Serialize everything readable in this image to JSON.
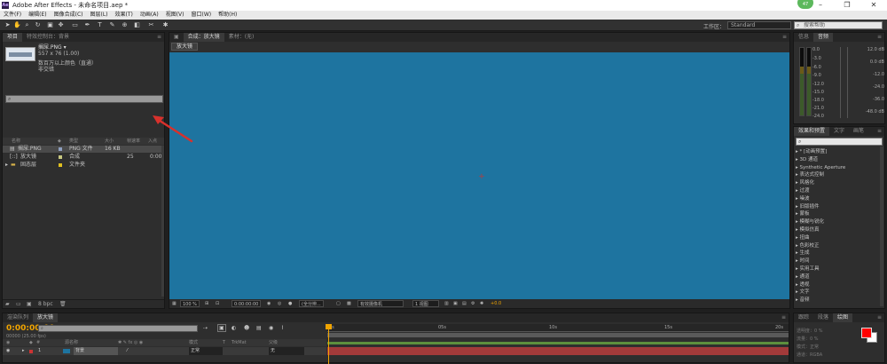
{
  "window": {
    "title": "Adobe After Effects - 未命名项目.aep *",
    "app_icon": "Ae",
    "badge": "47"
  },
  "menu": [
    "文件(F)",
    "编辑(E)",
    "图像合成(C)",
    "图层(L)",
    "效果(T)",
    "动画(A)",
    "视图(V)",
    "窗口(W)",
    "帮助(H)"
  ],
  "toolbar": {
    "workspace_label": "工作区：",
    "workspace_value": "Standard",
    "help_placeholder": "搜索帮助"
  },
  "project": {
    "tabs": [
      "项目",
      "特效控制台：背景"
    ],
    "selected_name": "搁尿.PNG ▾",
    "selected_dims": "557 x 76 (1.00)",
    "selected_info1": "数百万以上颜色（直通）",
    "selected_info2": "非交错",
    "columns": [
      "名称",
      "类型",
      "大小",
      "帧速率",
      "入点"
    ],
    "items": [
      {
        "name": "搁尿.PNG",
        "type": "PNG 文件",
        "size": "16 KB",
        "fps": "",
        "in": "",
        "color": "#8fa0c0"
      },
      {
        "name": "放大镜",
        "type": "合成",
        "size": "",
        "fps": "25",
        "in": "0:00",
        "color": "#c8c880"
      },
      {
        "name": "固态层",
        "type": "文件夹",
        "size": "",
        "fps": "",
        "in": "",
        "color": "#e0c020"
      }
    ],
    "footer_bpc": "8 bpc"
  },
  "comp": {
    "tabs": [
      "合成：放大镜",
      "素材：(无)"
    ],
    "subtab": "放大镜",
    "footer": {
      "zoom": "100 %",
      "timecode": "0:00:00:00",
      "resolution": "(全分辨...",
      "camera": "有效摄像机",
      "views": "1 视图",
      "exposure": "+0.0"
    }
  },
  "info": {
    "tabs": [
      "信息",
      "音频"
    ],
    "left_levels": [
      "0.0",
      "-3.0",
      "-6.0",
      "-9.0",
      "-12.0",
      "-15.0",
      "-18.0",
      "-21.0",
      "-24.0"
    ],
    "right_levels": [
      "12.0 dB",
      "0.0 dB",
      "-12.0",
      "-24.0",
      "-36.0",
      "-48.0 dB"
    ]
  },
  "effects": {
    "tabs": [
      "效果和预置",
      "文字",
      "画笔"
    ],
    "items": [
      "* [动画预置]",
      "3D 通道",
      "Synthetic Aperture",
      "表达式控制",
      "风格化",
      "过渡",
      "噪波",
      "旧版插件",
      "蒙板",
      "模糊与锐化",
      "模拟仿真",
      "扭曲",
      "色彩校正",
      "生成",
      "时间",
      "实用工具",
      "通道",
      "透视",
      "文字",
      "音频"
    ]
  },
  "timeline": {
    "tabs": [
      "渲染队列",
      "放大镜"
    ],
    "time": "0:00:00:00",
    "fps": "00000 (25.00 fps)",
    "columns": [
      "#",
      "源名称",
      "模式",
      "T",
      "TrkMat",
      "父级"
    ],
    "layer": {
      "index": "1",
      "name": "背景",
      "mode": "正常",
      "parent": "无"
    },
    "ruler": [
      "0s",
      "05s",
      "10s",
      "15s",
      "20s"
    ]
  },
  "paragraph": {
    "tabs": [
      "跟踪",
      "段落",
      "绘图"
    ],
    "labels": [
      "透明度：0 %",
      "流量：0 %",
      "模式：正常",
      "通道：RGBA"
    ]
  },
  "colors": {
    "viewport": "#1e74a0",
    "timecode": "#f0a400",
    "fg_swatch": "#ff0000",
    "arrow": "#d8312c",
    "layer_bar": "#a33a3a"
  }
}
